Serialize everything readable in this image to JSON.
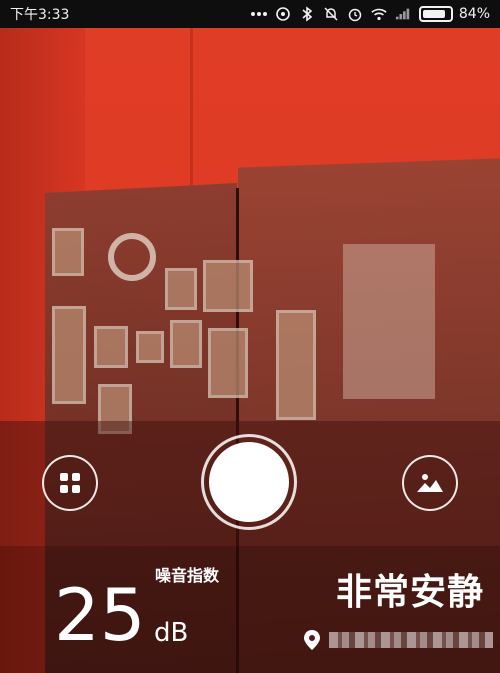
{
  "status_bar": {
    "time": "下午3:33",
    "battery_percent": 84,
    "battery_label": "84%",
    "icons": [
      "more-dots-icon",
      "sync-icon",
      "bluetooth-icon",
      "mute-icon",
      "alarm-icon",
      "wifi-icon",
      "signal-icon",
      "battery-icon"
    ]
  },
  "camera": {
    "buttons": {
      "grid_icon": "grid-icon",
      "gallery_icon": "gallery-icon",
      "shutter": "shutter-button"
    }
  },
  "noise": {
    "label": "噪音指数",
    "value": "25",
    "unit": "dB",
    "level": "非常安静",
    "location": "",
    "location_icon": "location-pin-icon"
  },
  "colors": {
    "wall_red": "#e03d26",
    "overlay_dark": "#3c0e0a",
    "text_white": "#ffffff"
  }
}
